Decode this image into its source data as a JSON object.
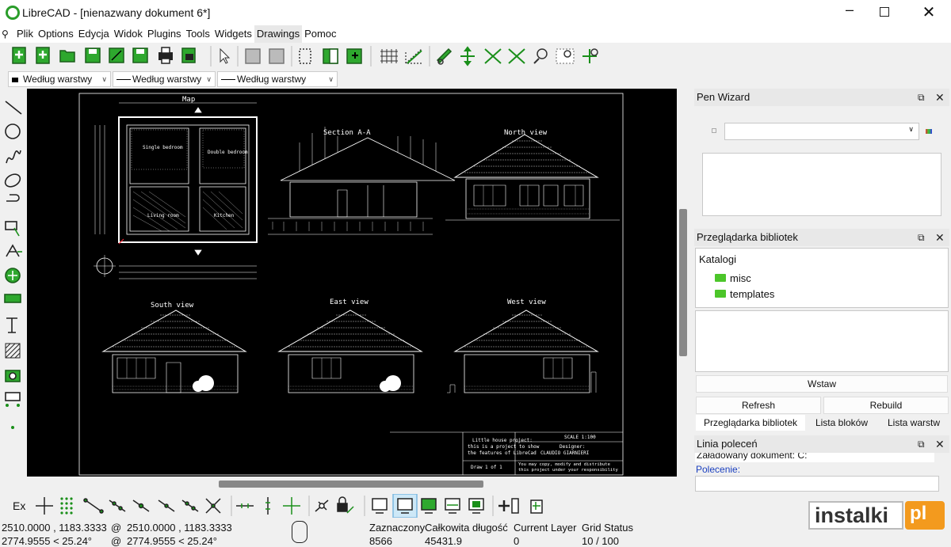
{
  "window": {
    "title": "LibreCAD - [nienazwany dokument 6*]"
  },
  "menu": [
    "Plik",
    "Options",
    "Edycja",
    "Widok",
    "Plugins",
    "Tools",
    "Widgets",
    "Drawings",
    "Pomoc"
  ],
  "toolbar2": {
    "layer_combo_1": "Według warstwy",
    "layer_combo_2": "Według warstwy",
    "layer_combo_3": "Według warstwy"
  },
  "drawing": {
    "map_label": "Map",
    "section_label": "Section A-A",
    "north_label": "North view",
    "south_label": "South view",
    "east_label": "East view",
    "west_label": "West view",
    "single_bedroom": "Single bedroom",
    "double_bedroom": "Double bedroom",
    "living_room": "Living room",
    "kitchen": "Kitchen",
    "scale": "SCALE 1:100",
    "title_line1": "Little house project:",
    "title_line2": "this is a project to show",
    "title_line3": "the features of LibreCad",
    "designer_label": "Designer:",
    "designer_name": "CLAUDIO GIARNIERI",
    "draw_of": "Draw 1 of 1",
    "license1": "You may copy, modify and distribute",
    "license2": "this project under your responsibility"
  },
  "pen_wizard": {
    "title": "Pen Wizard"
  },
  "library": {
    "title": "Przeglądarka bibliotek",
    "header": "Katalogi",
    "folders": [
      "misc",
      "templates"
    ],
    "insert": "Wstaw",
    "refresh": "Refresh",
    "rebuild": "Rebuild",
    "tabs": [
      "Przeglądarka bibliotek",
      "Lista bloków",
      "Lista warstw"
    ]
  },
  "command": {
    "title": "Linia poleceń",
    "log": "Załadowany dokument: C:",
    "prompt": "Polecenie:"
  },
  "bottom_toolbar": {
    "ex_label": "Ex"
  },
  "status": {
    "abs_coord_1": "2510.0000 , 1183.3333",
    "abs_coord_2": "2774.9555 < 25.24°",
    "rel_coord_1": "2510.0000 , 1183.3333",
    "rel_coord_2": "2774.9555 < 25.24°",
    "rel_prefix": "@",
    "selected_label": "Zaznaczony",
    "selected_value": "8566",
    "total_length_label": "Całkowita długość",
    "total_length_value": "45431.9",
    "layer_label": "Current Layer",
    "layer_value": "0",
    "grid_label": "Grid Status",
    "grid_value": "10 / 100"
  },
  "watermark": {
    "text": "instalki",
    "suffix": "pl"
  },
  "colors": {
    "accent": "#1a8f1a",
    "canvas": "#000000",
    "watermark_orange": "#f39a1e"
  }
}
